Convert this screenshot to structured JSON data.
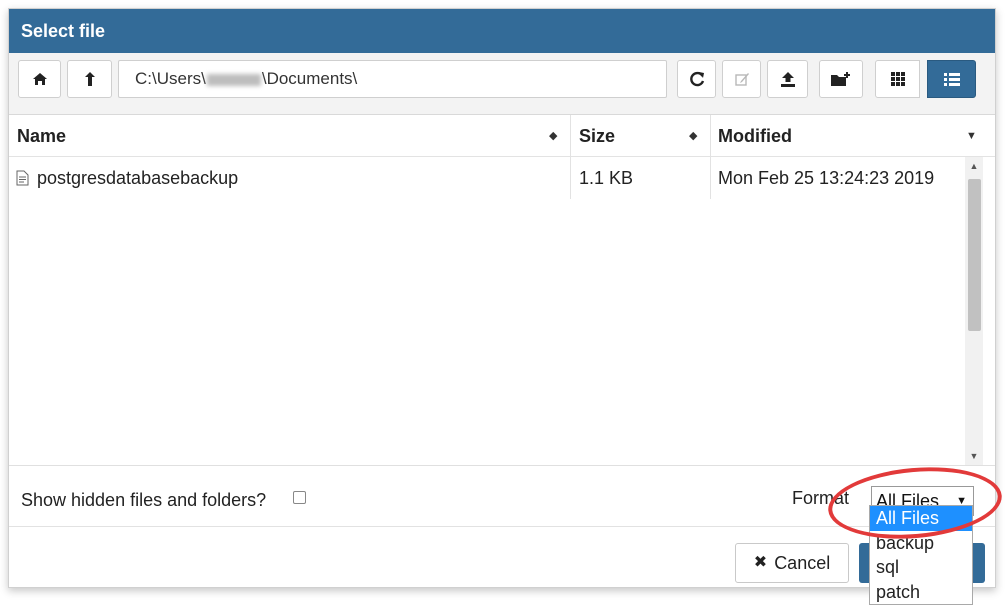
{
  "dialog": {
    "title": "Select file"
  },
  "toolbar": {
    "path_prefix": "C:\\Users\\",
    "path_suffix": "\\Documents\\",
    "icons": {
      "home": "home-icon",
      "up": "up-arrow-icon",
      "refresh": "refresh-icon",
      "rename": "edit-icon",
      "upload": "upload-icon",
      "new_folder": "new-folder-icon",
      "grid_view": "grid-view-icon",
      "list_view": "list-view-icon"
    }
  },
  "table": {
    "columns": [
      "Name",
      "Size",
      "Modified"
    ],
    "rows": [
      {
        "name": "postgresdatabasebackup",
        "size": "1.1 KB",
        "modified": "Mon Feb 25 13:24:23 2019"
      }
    ]
  },
  "footer": {
    "show_hidden_label": "Show hidden files and folders?",
    "format_label": "Format",
    "format_selected": "All Files",
    "format_options": [
      "All Files",
      "backup",
      "sql",
      "patch"
    ],
    "cancel_label": "Cancel"
  },
  "colors": {
    "accent": "#336b98",
    "selected_option": "#1e90ff",
    "highlight": "#e23a3a"
  }
}
